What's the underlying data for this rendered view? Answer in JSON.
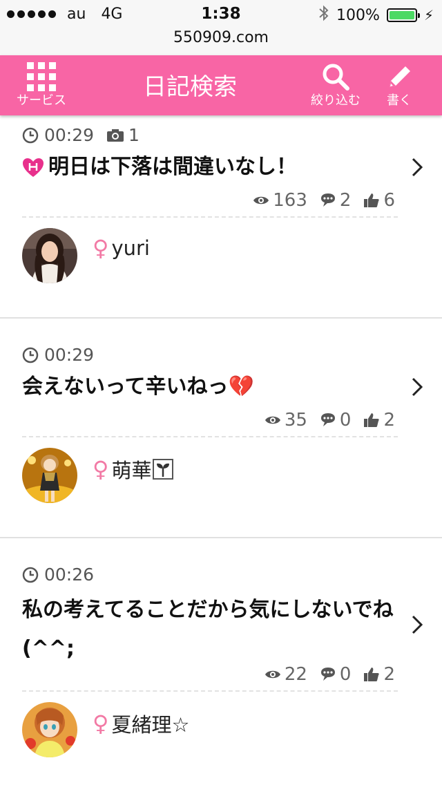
{
  "status_bar": {
    "carrier": "au",
    "network": "4G",
    "time": "1:38",
    "battery": "100%"
  },
  "url": "550909.com",
  "header": {
    "services_label": "サービス",
    "title": "日記検索",
    "search_label": "絞り込む",
    "write_label": "書く",
    "color": "#f865a5"
  },
  "posts": [
    {
      "time": "00:29",
      "photo_count": "1",
      "title": "明日は下落は間違いなし！",
      "views": "163",
      "comments": "2",
      "likes": "6",
      "user": "yuri"
    },
    {
      "time": "00:29",
      "title": "会えないって辛いねっ💔",
      "views": "35",
      "comments": "0",
      "likes": "2",
      "user": "萌華"
    },
    {
      "time": "00:26",
      "title": "私の考えてることだから気にしないでね(^^;",
      "views": "22",
      "comments": "0",
      "likes": "2",
      "user": "夏緒理☆"
    }
  ],
  "female_symbol": "♀"
}
